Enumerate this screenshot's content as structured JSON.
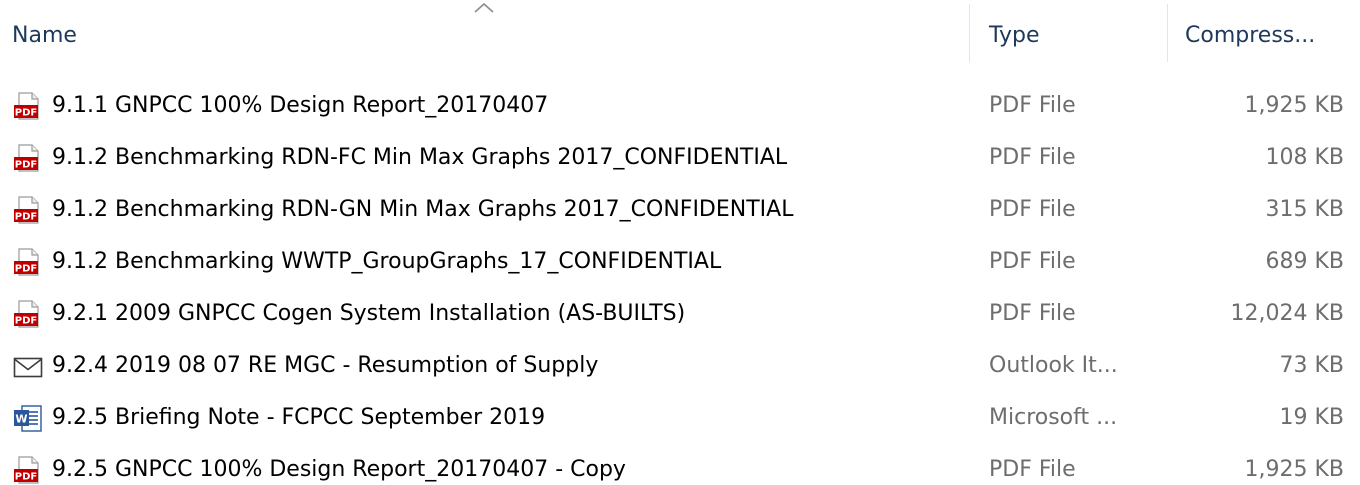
{
  "header": {
    "name_label": "Name",
    "type_label": "Type",
    "compressed_label": "Compress...",
    "sort_indicator": "sort-ascending-icon"
  },
  "colors": {
    "header_text": "#1e395b",
    "secondary_text": "#6d6d6d",
    "pdf_red": "#c00000",
    "word_blue": "#2b579a"
  },
  "files": [
    {
      "name": "9.1.1 GNPCC 100% Design Report_20170407",
      "type": "PDF File",
      "size": "1,925 KB",
      "icon": "pdf-icon"
    },
    {
      "name": "9.1.2 Benchmarking RDN-FC Min Max Graphs 2017_CONFIDENTIAL",
      "type": "PDF File",
      "size": "108 KB",
      "icon": "pdf-icon"
    },
    {
      "name": "9.1.2 Benchmarking RDN-GN Min Max Graphs 2017_CONFIDENTIAL",
      "type": "PDF File",
      "size": "315 KB",
      "icon": "pdf-icon"
    },
    {
      "name": "9.1.2 Benchmarking WWTP_GroupGraphs_17_CONFIDENTIAL",
      "type": "PDF File",
      "size": "689 KB",
      "icon": "pdf-icon"
    },
    {
      "name": "9.2.1 2009 GNPCC Cogen System Installation (AS-BUILTS)",
      "type": "PDF File",
      "size": "12,024 KB",
      "icon": "pdf-icon"
    },
    {
      "name": "9.2.4 2019 08 07 RE MGC - Resumption of Supply",
      "type": "Outlook It...",
      "size": "73 KB",
      "icon": "envelope-icon"
    },
    {
      "name": "9.2.5 Briefing Note - FCPCC September 2019",
      "type": "Microsoft ...",
      "size": "19 KB",
      "icon": "word-document-icon"
    },
    {
      "name": "9.2.5 GNPCC 100% Design Report_20170407 - Copy",
      "type": "PDF File",
      "size": "1,925 KB",
      "icon": "pdf-icon"
    }
  ]
}
